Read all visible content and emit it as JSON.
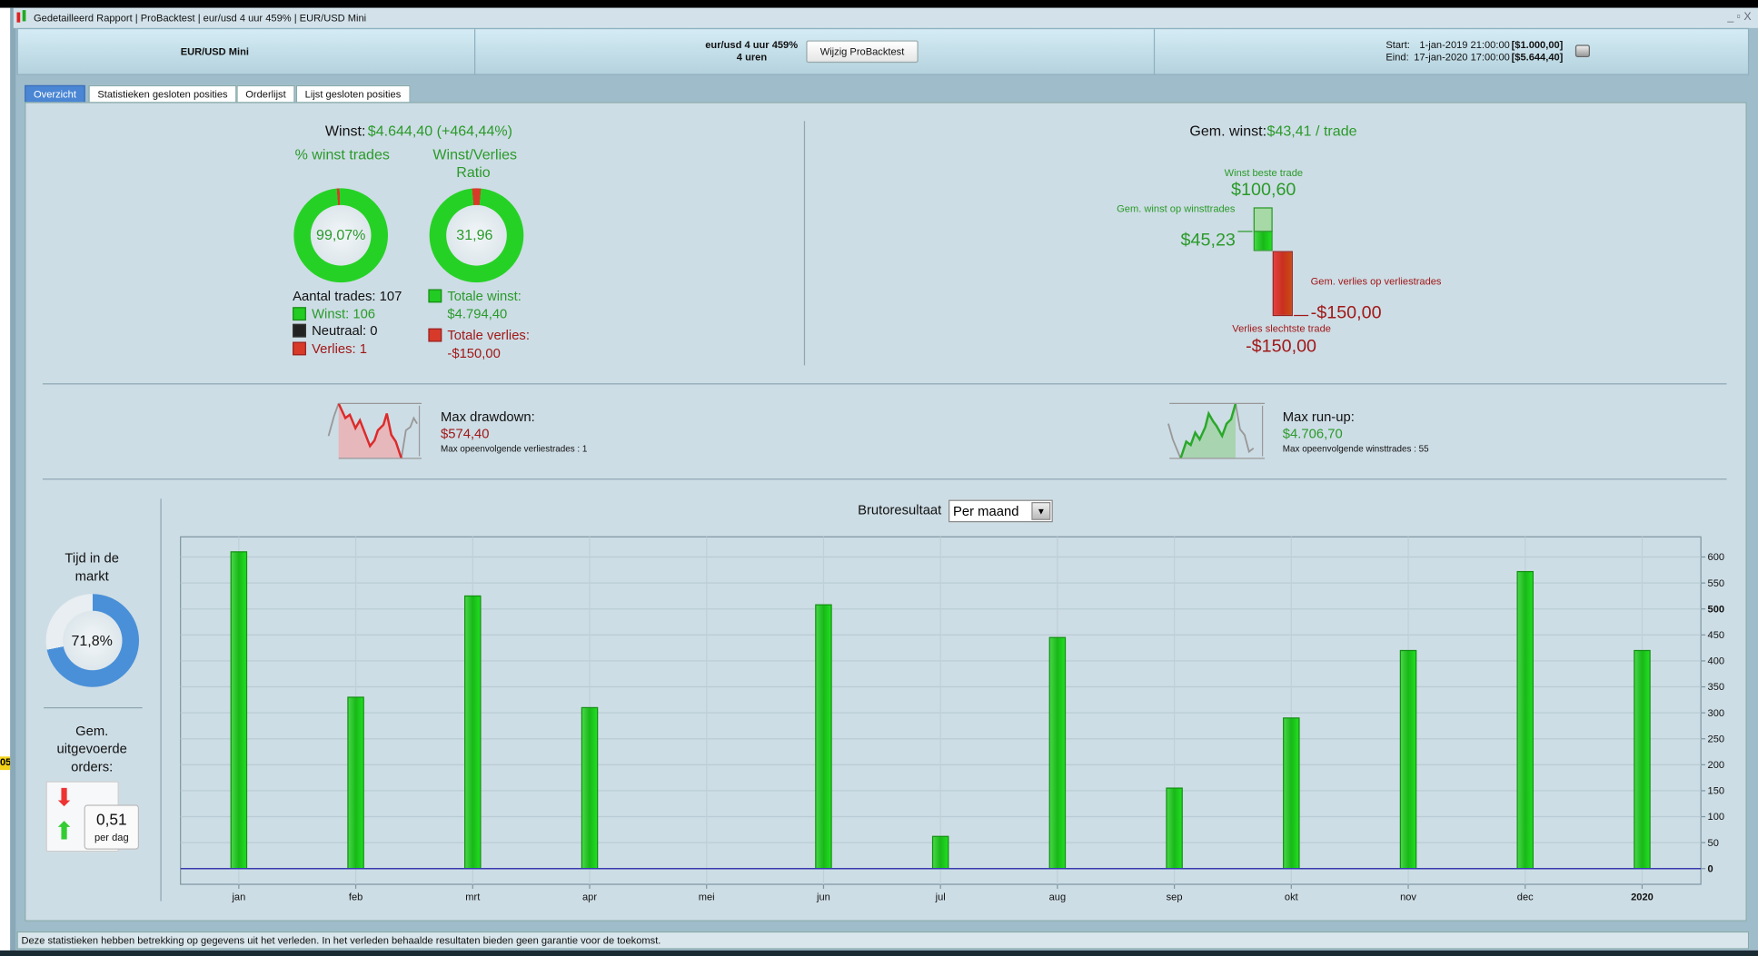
{
  "window": {
    "title": "Gedetailleerd Rapport | ProBacktest | eur/usd 4 uur 459% | EUR/USD Mini",
    "controls": "_ ▫ X",
    "side_badge": "05"
  },
  "header": {
    "instrument": "EUR/USD Mini",
    "system_name": "eur/usd 4 uur 459%",
    "timeframe": "4 uren",
    "modify_button": "Wijzig ProBacktest",
    "start_label": "Start:",
    "start_value": "1-jan-2019 21:00:00",
    "start_capital": "[$1.000,00]",
    "end_label": "Eind:",
    "end_value": "17-jan-2020 17:00:00",
    "end_capital": "[$5.644,40]"
  },
  "tabs": [
    {
      "label": "Overzicht",
      "active": true
    },
    {
      "label": "Statistieken gesloten posities"
    },
    {
      "label": "Orderlijst"
    },
    {
      "label": "Lijst gesloten posities"
    }
  ],
  "summary": {
    "profit_label": "Winst:",
    "profit_value": "$4.644,40 (+464,44%)",
    "pct_win_title": "% winst trades",
    "pct_win_value": "99,07%",
    "pct_win_fraction": 0.9907,
    "ratio_title_1": "Winst/Verlies",
    "ratio_title_2": "Ratio",
    "ratio_value": "31,96",
    "ratio_loss_fraction": 0.0303,
    "trades_count": "Aantal trades: 107",
    "wins": "Winst: 106",
    "neutral": "Neutraal: 0",
    "losses": "Verlies: 1",
    "total_win_label": "Totale winst:",
    "total_win_value": "$4.794,40",
    "total_loss_label": "Totale verlies:",
    "total_loss_value": "-$150,00"
  },
  "avg": {
    "label": "Gem. winst:",
    "value": "$43,41 / trade",
    "best_label": "Winst beste trade",
    "best_value": "$100,60",
    "avg_win_label": "Gem. winst op winsttrades",
    "avg_win_value": "$45,23",
    "avg_loss_label": "Gem. verlies op verliestrades",
    "avg_loss_value": "-$150,00",
    "worst_label": "Verlies slechtste trade",
    "worst_value": "-$150,00"
  },
  "drawdown": {
    "label": "Max drawdown:",
    "value": "$574,40",
    "sub": "Max opeenvolgende verliestrades : 1"
  },
  "runup": {
    "label": "Max run-up:",
    "value": "$4.706,70",
    "sub": "Max opeenvolgende winsttrades : 55"
  },
  "market": {
    "title_1": "Tijd in de",
    "title_2": "markt",
    "value": "71,8%",
    "fraction": 0.718
  },
  "orders": {
    "title_1": "Gem.",
    "title_2": "uitgevoerde",
    "title_3": "orders:",
    "value": "0,51",
    "unit": "per dag"
  },
  "chart_title": "Brutoresultaat",
  "period_select": "Per maand",
  "chart_data": {
    "type": "bar",
    "categories": [
      "jan",
      "feb",
      "mrt",
      "apr",
      "mei",
      "jun",
      "jul",
      "aug",
      "sep",
      "okt",
      "nov",
      "dec",
      "2020"
    ],
    "values": [
      610,
      330,
      525,
      310,
      0,
      508,
      62,
      445,
      155,
      290,
      420,
      572,
      420
    ],
    "ylim": [
      -25,
      630
    ],
    "yticks": [
      0,
      50,
      100,
      150,
      200,
      250,
      300,
      350,
      400,
      450,
      500,
      550,
      600
    ],
    "bold_ticks": [
      0,
      500
    ],
    "bold_categories": [
      "2020"
    ],
    "grid": true,
    "bar_color": "#22cc22",
    "zero_line_color": "#3a3ab0"
  },
  "status": "Deze statistieken hebben betrekking op gegevens uit het verleden. In het verleden behaalde resultaten bieden geen garantie voor de toekomst."
}
